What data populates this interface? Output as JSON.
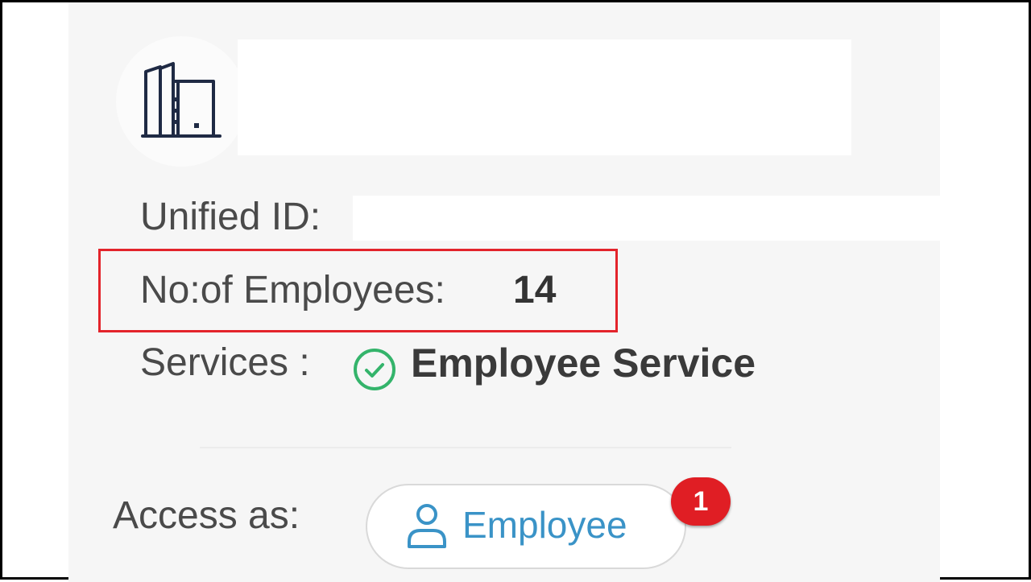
{
  "company": {
    "logo_icon": "building-icon",
    "name": ""
  },
  "details": {
    "unified_id_label": "Unified ID:",
    "unified_id_value": "",
    "employees_label": "No:of Employees:",
    "employees_count": "14",
    "services_label": "Services :",
    "service_icon": "check-circle-icon",
    "service_name": "Employee Service"
  },
  "access": {
    "label": "Access as:",
    "button_icon": "person-icon",
    "button_label": "Employee",
    "badge_count": "1"
  },
  "colors": {
    "highlight_border": "#e3242b",
    "check_green": "#34b46b",
    "employee_blue": "#3a93c7",
    "badge_red": "#e01e24",
    "logo_navy": "#1f2a44"
  }
}
